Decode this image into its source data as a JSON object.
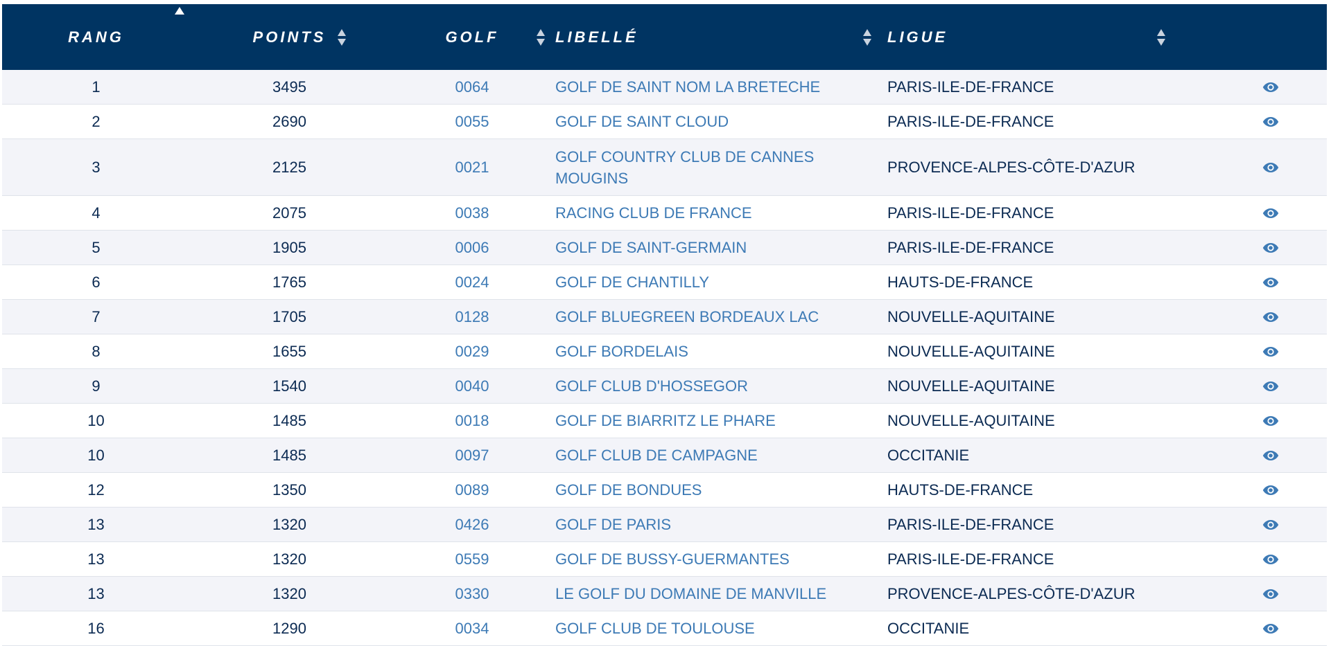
{
  "colors": {
    "header_bg": "#003462",
    "link": "#3d7ab5",
    "text": "#0b2a52",
    "row_alt": "#f3f4f9"
  },
  "header": {
    "rang": "RANG",
    "points": "POINTS",
    "golf": "GOLF",
    "libelle": "LIBELLÉ",
    "ligue": "LIGUE"
  },
  "sort": {
    "active_column": "rang",
    "direction": "ascending"
  },
  "rows": [
    {
      "rang": "1",
      "points": "3495",
      "golf": "0064",
      "libelle": "GOLF DE SAINT NOM LA BRETECHE",
      "ligue": "PARIS-ILE-DE-FRANCE",
      "action_icon": "eye-icon"
    },
    {
      "rang": "2",
      "points": "2690",
      "golf": "0055",
      "libelle": "GOLF DE SAINT CLOUD",
      "ligue": "PARIS-ILE-DE-FRANCE",
      "action_icon": "eye-icon"
    },
    {
      "rang": "3",
      "points": "2125",
      "golf": "0021",
      "libelle": "GOLF COUNTRY CLUB DE CANNES MOUGINS",
      "ligue": "PROVENCE-ALPES-CÔTE-D'AZUR",
      "action_icon": "eye-icon"
    },
    {
      "rang": "4",
      "points": "2075",
      "golf": "0038",
      "libelle": "RACING CLUB DE FRANCE",
      "ligue": "PARIS-ILE-DE-FRANCE",
      "action_icon": "eye-icon"
    },
    {
      "rang": "5",
      "points": "1905",
      "golf": "0006",
      "libelle": "GOLF DE SAINT-GERMAIN",
      "ligue": "PARIS-ILE-DE-FRANCE",
      "action_icon": "eye-icon"
    },
    {
      "rang": "6",
      "points": "1765",
      "golf": "0024",
      "libelle": "GOLF DE CHANTILLY",
      "ligue": "HAUTS-DE-FRANCE",
      "action_icon": "eye-icon"
    },
    {
      "rang": "7",
      "points": "1705",
      "golf": "0128",
      "libelle": "GOLF BLUEGREEN BORDEAUX LAC",
      "ligue": "NOUVELLE-AQUITAINE",
      "action_icon": "eye-icon"
    },
    {
      "rang": "8",
      "points": "1655",
      "golf": "0029",
      "libelle": "GOLF BORDELAIS",
      "ligue": "NOUVELLE-AQUITAINE",
      "action_icon": "eye-icon"
    },
    {
      "rang": "9",
      "points": "1540",
      "golf": "0040",
      "libelle": "GOLF CLUB D'HOSSEGOR",
      "ligue": "NOUVELLE-AQUITAINE",
      "action_icon": "eye-icon"
    },
    {
      "rang": "10",
      "points": "1485",
      "golf": "0018",
      "libelle": "GOLF DE BIARRITZ LE PHARE",
      "ligue": "NOUVELLE-AQUITAINE",
      "action_icon": "eye-icon"
    },
    {
      "rang": "10",
      "points": "1485",
      "golf": "0097",
      "libelle": "GOLF CLUB DE CAMPAGNE",
      "ligue": "OCCITANIE",
      "action_icon": "eye-icon"
    },
    {
      "rang": "12",
      "points": "1350",
      "golf": "0089",
      "libelle": "GOLF DE BONDUES",
      "ligue": "HAUTS-DE-FRANCE",
      "action_icon": "eye-icon"
    },
    {
      "rang": "13",
      "points": "1320",
      "golf": "0426",
      "libelle": "GOLF DE PARIS",
      "ligue": "PARIS-ILE-DE-FRANCE",
      "action_icon": "eye-icon"
    },
    {
      "rang": "13",
      "points": "1320",
      "golf": "0559",
      "libelle": "GOLF DE BUSSY-GUERMANTES",
      "ligue": "PARIS-ILE-DE-FRANCE",
      "action_icon": "eye-icon"
    },
    {
      "rang": "13",
      "points": "1320",
      "golf": "0330",
      "libelle": "LE GOLF DU DOMAINE DE MANVILLE",
      "ligue": "PROVENCE-ALPES-CÔTE-D'AZUR",
      "action_icon": "eye-icon"
    },
    {
      "rang": "16",
      "points": "1290",
      "golf": "0034",
      "libelle": "GOLF CLUB DE TOULOUSE",
      "ligue": "OCCITANIE",
      "action_icon": "eye-icon"
    }
  ]
}
